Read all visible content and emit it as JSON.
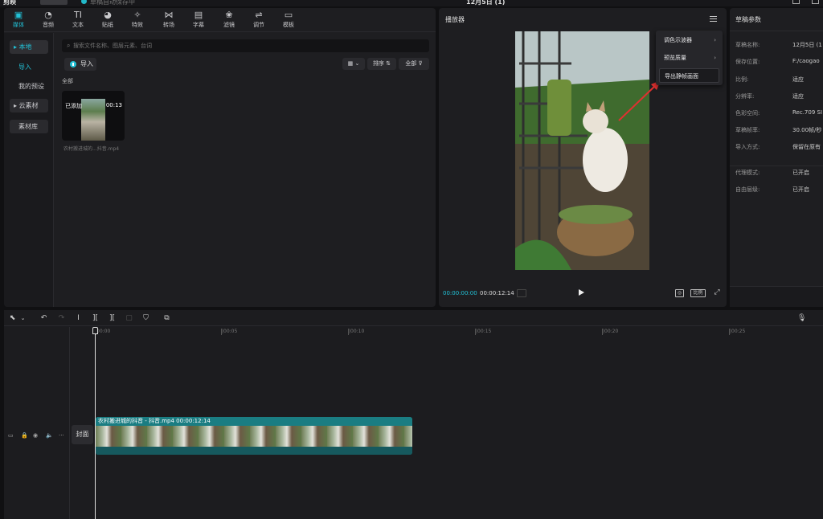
{
  "app": {
    "logo": "剪映",
    "menu_label": "菜单",
    "status": "草稿自动保存中",
    "window_title": "12月5日 (1)"
  },
  "media_tabs": [
    {
      "label": "媒体",
      "icon": "media-icon"
    },
    {
      "label": "音频",
      "icon": "audio-icon"
    },
    {
      "label": "文本",
      "icon": "text-icon"
    },
    {
      "label": "贴纸",
      "icon": "sticker-icon"
    },
    {
      "label": "特效",
      "icon": "effects-icon"
    },
    {
      "label": "转场",
      "icon": "transition-icon"
    },
    {
      "label": "字幕",
      "icon": "subtitle-icon"
    },
    {
      "label": "滤镜",
      "icon": "filter-icon"
    },
    {
      "label": "调节",
      "icon": "adjust-icon"
    },
    {
      "label": "模板",
      "icon": "template-icon"
    }
  ],
  "media_nav": [
    {
      "label": "▸ 本地"
    },
    {
      "label": "导入"
    },
    {
      "label": "我的预设"
    },
    {
      "label": "▸ 云素材"
    },
    {
      "label": "素材库"
    }
  ],
  "search": {
    "placeholder": "搜索文件名称、图层元素、台词"
  },
  "import_label": "导入",
  "toolbar": {
    "sort_label": "排序",
    "filter_label": "全部"
  },
  "section_label": "全部",
  "media_item": {
    "tag": "已添加",
    "duration": "00:13",
    "name": "农村搬进城的...抖音.mp4"
  },
  "player": {
    "title": "播放器",
    "time_current": "00:00:00:00",
    "time_total": "00:00:12:14",
    "ratio_label": "比例"
  },
  "context_menu": [
    {
      "label": "调色示波器",
      "has_submenu": true
    },
    {
      "label": "预览质量",
      "has_submenu": true
    },
    {
      "label": "导出静帧画面",
      "has_submenu": false
    }
  ],
  "draft": {
    "title": "草稿参数",
    "rows": [
      {
        "key": "草稿名称:",
        "value": "12月5日 (1"
      },
      {
        "key": "保存位置:",
        "value": "F:/caogao"
      },
      {
        "key": "比例:",
        "value": "适应"
      },
      {
        "key": "分辨率:",
        "value": "适应"
      },
      {
        "key": "色彩空间:",
        "value": "Rec.709 SI"
      },
      {
        "key": "草稿帧率:",
        "value": "30.00帧/秒"
      },
      {
        "key": "导入方式:",
        "value": "保留在原有"
      }
    ],
    "rows2": [
      {
        "key": "代理模式:",
        "value": "已开启"
      },
      {
        "key": "自由层级:",
        "value": "已开启"
      }
    ]
  },
  "timeline": {
    "ticks": [
      "00:00",
      "|00:05",
      "|00:10",
      "|00:15",
      "|00:20",
      "|00:25"
    ],
    "cover_label": "封面",
    "clip_title": "农村搬进城的抖音 - 抖音.mp4  00:00:12:14"
  },
  "colors": {
    "accent": "#22c1d6",
    "clip": "#1d6e74",
    "arrow": "#e03030"
  }
}
